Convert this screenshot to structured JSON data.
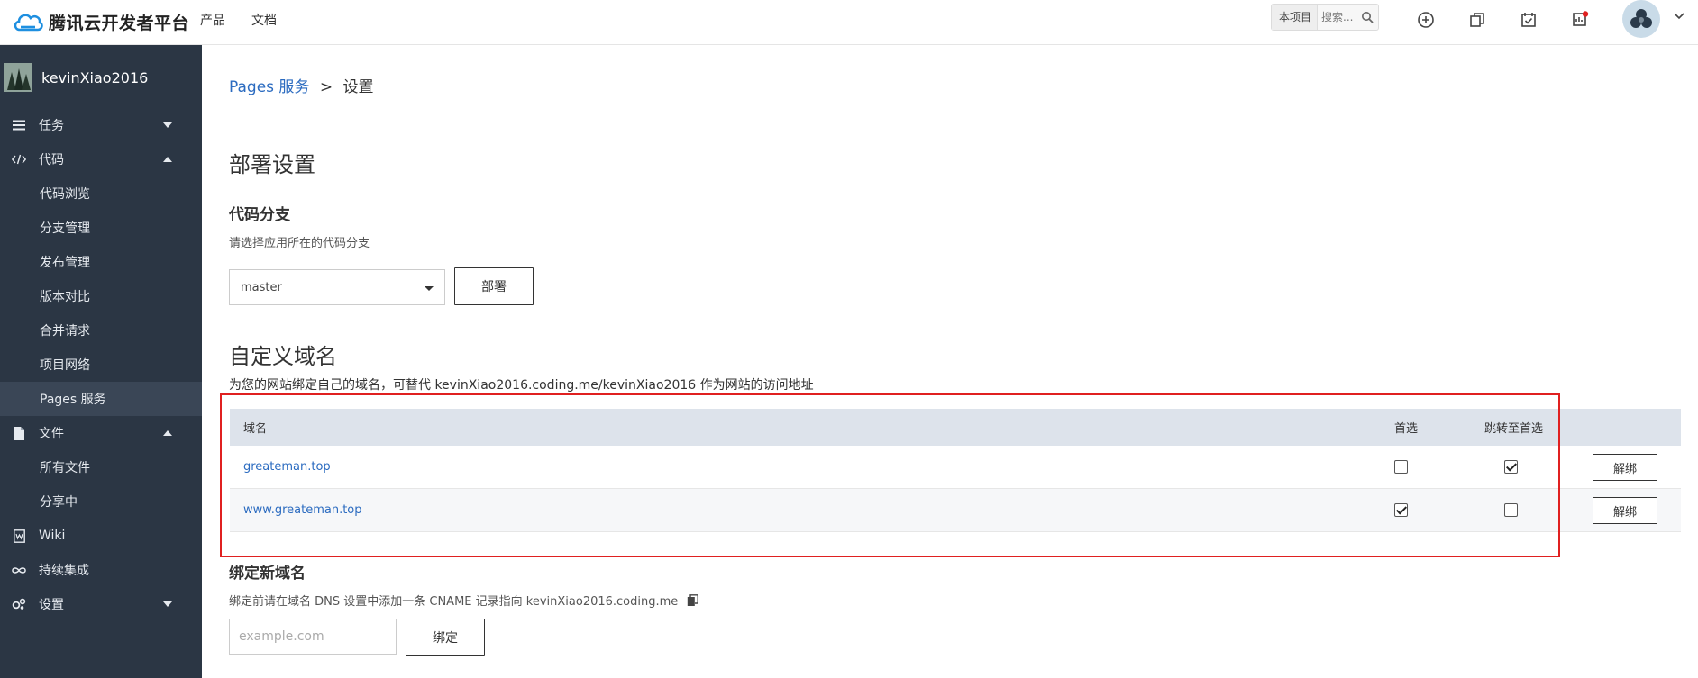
{
  "header": {
    "brand": "腾讯云开发者平台",
    "nav": [
      "产品",
      "文档"
    ],
    "search": {
      "scope": "本项目",
      "placeholder": "搜索..."
    },
    "icons": [
      "plus-circle-icon",
      "copy-icon",
      "calendar-check-icon",
      "notification-icon"
    ]
  },
  "sidebar": {
    "username": "kevinXiao2016",
    "items": [
      {
        "label": "任务",
        "icon": "tasks-icon",
        "caret": "down"
      },
      {
        "label": "代码",
        "icon": "code-icon",
        "caret": "up"
      },
      {
        "label": "代码浏览"
      },
      {
        "label": "分支管理"
      },
      {
        "label": "发布管理"
      },
      {
        "label": "版本对比"
      },
      {
        "label": "合并请求"
      },
      {
        "label": "项目网络"
      },
      {
        "label": "Pages 服务",
        "active": true
      },
      {
        "label": "文件",
        "icon": "file-icon",
        "caret": "up"
      },
      {
        "label": "所有文件"
      },
      {
        "label": "分享中"
      },
      {
        "label": "Wiki",
        "icon": "wiki-icon"
      },
      {
        "label": "持续集成",
        "icon": "infinity-icon"
      },
      {
        "label": "设置",
        "icon": "gears-icon",
        "caret": "down"
      }
    ]
  },
  "breadcrumb": {
    "parent": "Pages 服务",
    "separator": ">",
    "current": "设置"
  },
  "deploy": {
    "title": "部署设置",
    "branch_title": "代码分支",
    "branch_desc": "请选择应用所在的代码分支",
    "branch_value": "master",
    "deploy_button": "部署"
  },
  "custom_domain": {
    "title": "自定义域名",
    "desc": "为您的网站绑定自己的域名，可替代 kevinXiao2016.coding.me/kevinXiao2016 作为网站的访问地址",
    "columns": {
      "domain": "域名",
      "preferred": "首选",
      "redirect": "跳转至首选"
    },
    "rows": [
      {
        "domain": "greateman.top",
        "preferred": false,
        "redirect": true,
        "action": "解绑"
      },
      {
        "domain": "www.greateman.top",
        "preferred": true,
        "redirect": false,
        "action": "解绑"
      }
    ]
  },
  "bind_domain": {
    "title": "绑定新域名",
    "desc": "绑定前请在域名 DNS 设置中添加一条 CNAME 记录指向 kevinXiao2016.coding.me",
    "placeholder": "example.com",
    "bind_button": "绑定"
  },
  "colors": {
    "sidebar_bg": "#2b3644",
    "link": "#2b6bc0",
    "highlight": "#e02020",
    "table_header": "#dde3eb"
  }
}
